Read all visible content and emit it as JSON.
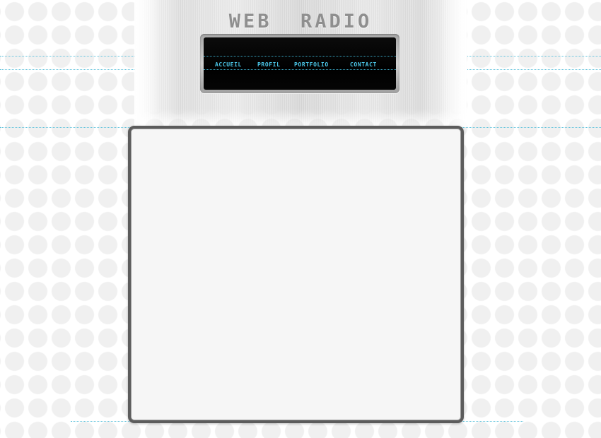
{
  "header": {
    "title": "WEB  RADIO"
  },
  "nav": {
    "items": [
      {
        "label": "ACCUEIL"
      },
      {
        "label": "PROFIL"
      },
      {
        "label": "PORTFOLIO"
      },
      {
        "label": "CONTACT"
      }
    ]
  },
  "colors": {
    "nav_text": "#4cc8ea",
    "guide_lines": "#62c3dc",
    "frame_border": "#5c5c5c",
    "frame_fill": "#f6f6f6"
  }
}
